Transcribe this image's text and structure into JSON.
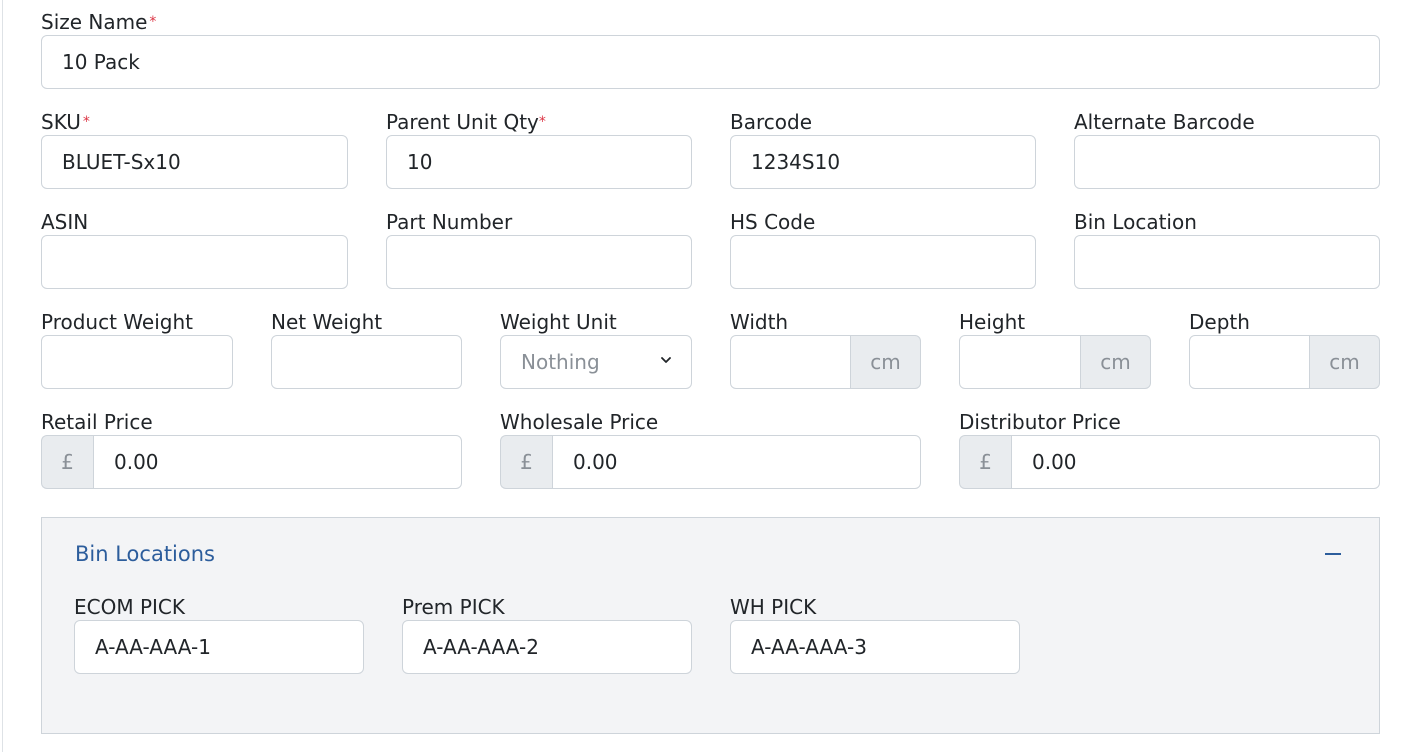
{
  "form": {
    "size_name": {
      "label": "Size Name",
      "required": "*",
      "value": "10 Pack"
    },
    "sku": {
      "label": "SKU",
      "required": "*",
      "value": "BLUET-Sx10"
    },
    "parent_unit_qty": {
      "label": "Parent Unit Qty",
      "required": "*",
      "value": "10"
    },
    "barcode": {
      "label": "Barcode",
      "value": "1234S10"
    },
    "alternate_barcode": {
      "label": "Alternate Barcode",
      "value": ""
    },
    "asin": {
      "label": "ASIN",
      "value": ""
    },
    "part_number": {
      "label": "Part Number",
      "value": ""
    },
    "hs_code": {
      "label": "HS Code",
      "value": ""
    },
    "bin_location": {
      "label": "Bin Location",
      "value": ""
    },
    "product_weight": {
      "label": "Product Weight",
      "value": ""
    },
    "net_weight": {
      "label": "Net Weight",
      "value": ""
    },
    "weight_unit": {
      "label": "Weight Unit",
      "selected": "Nothing"
    },
    "width": {
      "label": "Width",
      "value": "",
      "unit": "cm"
    },
    "height": {
      "label": "Height",
      "value": "",
      "unit": "cm"
    },
    "depth": {
      "label": "Depth",
      "value": "",
      "unit": "cm"
    },
    "retail_price": {
      "label": "Retail Price",
      "currency": "£",
      "value": "0.00"
    },
    "wholesale_price": {
      "label": "Wholesale Price",
      "currency": "£",
      "value": "0.00"
    },
    "distributor_price": {
      "label": "Distributor Price",
      "currency": "£",
      "value": "0.00"
    }
  },
  "bin_locations": {
    "title": "Bin Locations",
    "items": [
      {
        "label": "ECOM PICK",
        "value": "A-AA-AAA-1"
      },
      {
        "label": "Prem PICK",
        "value": "A-AA-AAA-2"
      },
      {
        "label": "WH PICK",
        "value": "A-AA-AAA-3"
      }
    ]
  },
  "colors": {
    "accent": "#2c5d9c",
    "required": "#dc3545",
    "panel_bg": "#f3f4f6",
    "addon_bg": "#e9ecef"
  }
}
